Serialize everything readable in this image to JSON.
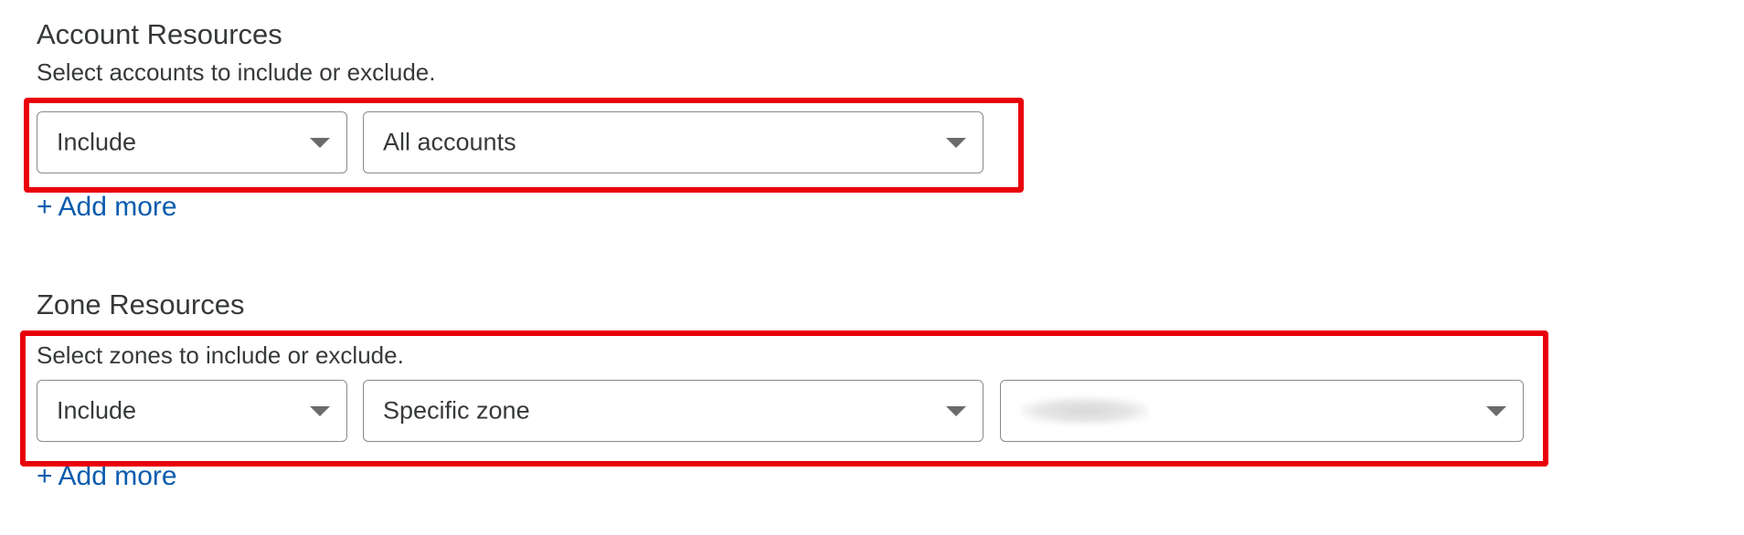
{
  "account_resources": {
    "title": "Account Resources",
    "description": "Select accounts to include or exclude.",
    "mode_select": {
      "value": "Include"
    },
    "scope_select": {
      "value": "All accounts"
    },
    "add_more_label": "Add more",
    "add_more_icon": "+"
  },
  "zone_resources": {
    "title": "Zone Resources",
    "description": "Select zones to include or exclude.",
    "mode_select": {
      "value": "Include"
    },
    "scope_select": {
      "value": "Specific zone"
    },
    "zone_select": {
      "value": ""
    },
    "add_more_label": "Add more",
    "add_more_icon": "+"
  },
  "colors": {
    "highlight": "#e8000b",
    "link": "#0b5cad",
    "border": "#8a8a8a",
    "text": "#36393a"
  },
  "icons": {
    "dropdown": "chevron-down-icon",
    "add": "plus-icon"
  }
}
